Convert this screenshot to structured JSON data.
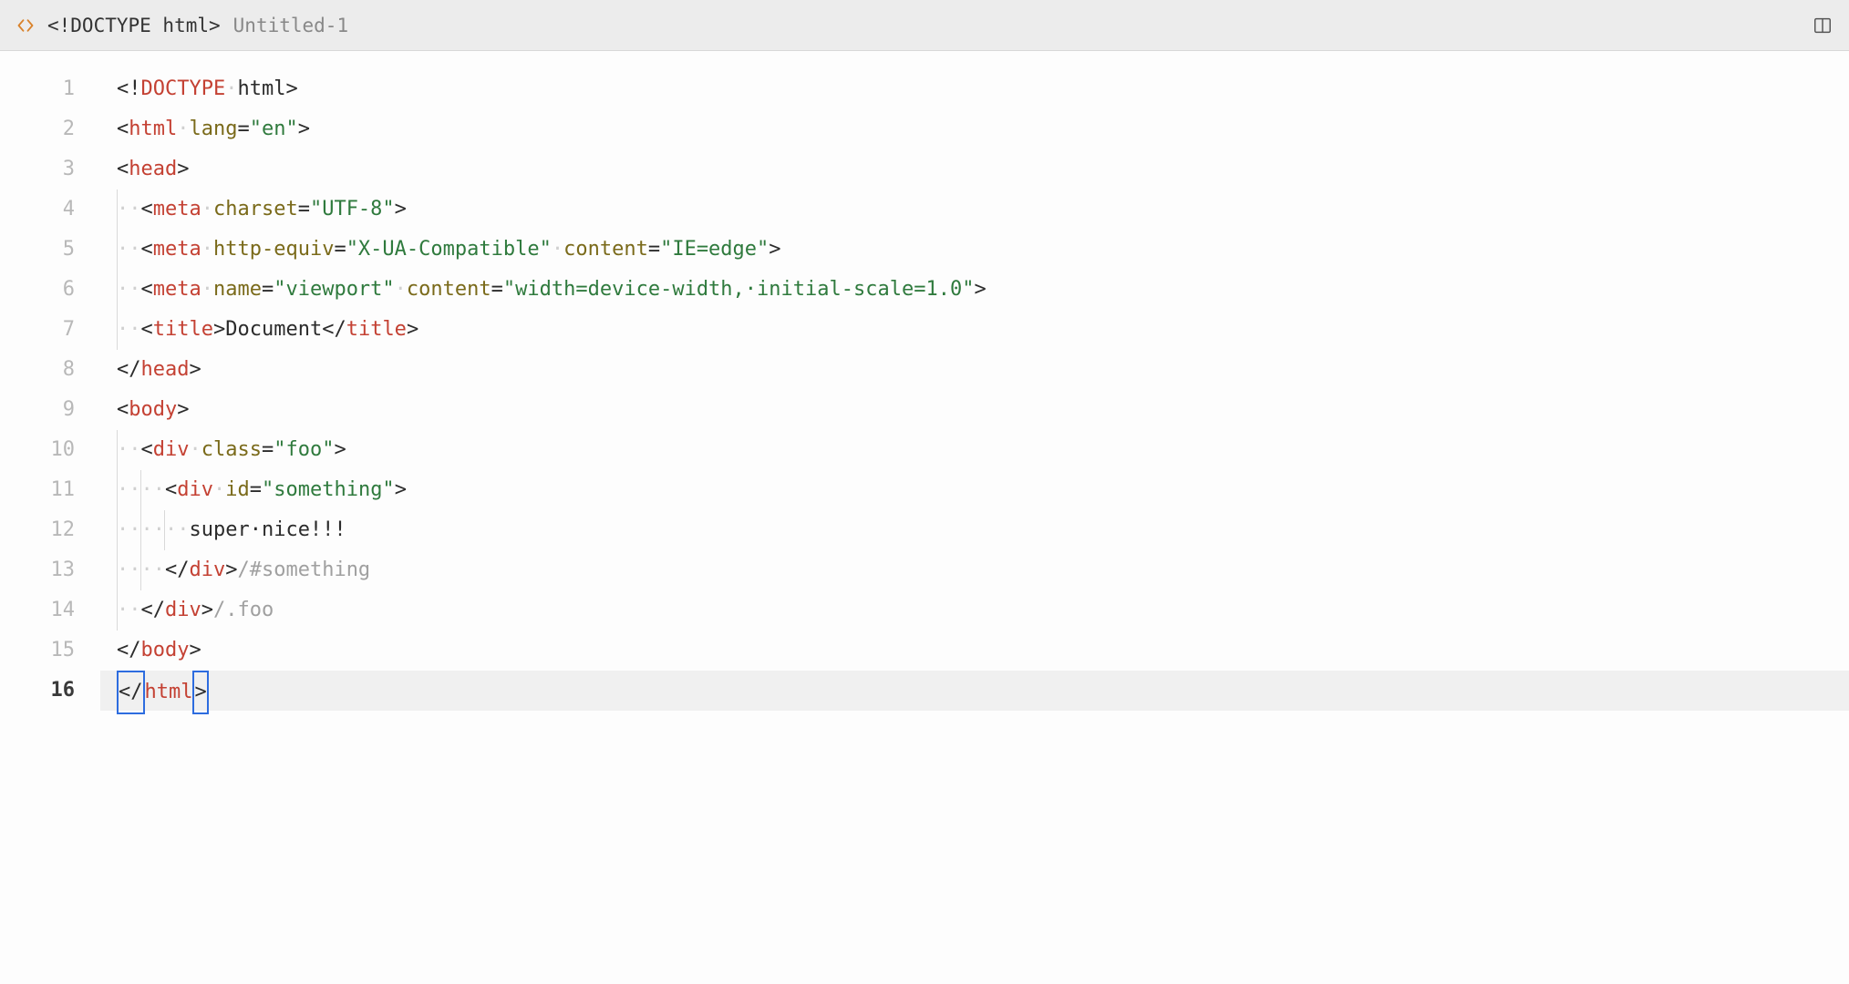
{
  "tab": {
    "doctype_label": "<!DOCTYPE html>",
    "filename": "Untitled-1"
  },
  "gutter": {
    "lines": [
      "1",
      "2",
      "3",
      "4",
      "5",
      "6",
      "7",
      "8",
      "9",
      "10",
      "11",
      "12",
      "13",
      "14",
      "15",
      "16"
    ],
    "current_line": 16
  },
  "code": {
    "line1": {
      "lt": "<",
      "bang": "!",
      "doctype": "DOCTYPE",
      "sp": "·",
      "html": "html",
      "gt": ">"
    },
    "line2": {
      "lt": "<",
      "tag": "html",
      "sp": "·",
      "attr": "lang",
      "eq": "=",
      "val": "\"en\"",
      "gt": ">"
    },
    "line3": {
      "lt": "<",
      "tag": "head",
      "gt": ">"
    },
    "line4": {
      "ws": "··",
      "lt": "<",
      "tag": "meta",
      "sp": "·",
      "attr": "charset",
      "eq": "=",
      "val": "\"UTF-8\"",
      "gt": ">"
    },
    "line5": {
      "ws": "··",
      "lt": "<",
      "tag": "meta",
      "sp": "·",
      "attr1": "http-equiv",
      "eq1": "=",
      "val1": "\"X-UA-Compatible\"",
      "sp2": "·",
      "attr2": "content",
      "eq2": "=",
      "val2": "\"IE=edge\"",
      "gt": ">"
    },
    "line6": {
      "ws": "··",
      "lt": "<",
      "tag": "meta",
      "sp": "·",
      "attr1": "name",
      "eq1": "=",
      "val1": "\"viewport\"",
      "sp2": "·",
      "attr2": "content",
      "eq2": "=",
      "val2": "\"width=device-width,·initial-scale=1.0\"",
      "gt": ">"
    },
    "line7": {
      "ws": "··",
      "lt": "<",
      "tag": "title",
      "gt": ">",
      "text": "Document",
      "lt2": "</",
      "tag2": "title",
      "gt2": ">"
    },
    "line8": {
      "lt": "</",
      "tag": "head",
      "gt": ">"
    },
    "line9": {
      "lt": "<",
      "tag": "body",
      "gt": ">"
    },
    "line10": {
      "ws": "··",
      "lt": "<",
      "tag": "div",
      "sp": "·",
      "attr": "class",
      "eq": "=",
      "val": "\"foo\"",
      "gt": ">"
    },
    "line11": {
      "ws": "····",
      "lt": "<",
      "tag": "div",
      "sp": "·",
      "attr": "id",
      "eq": "=",
      "val": "\"something\"",
      "gt": ">"
    },
    "line12": {
      "ws": "······",
      "text": "super·nice!!!"
    },
    "line13": {
      "ws": "····",
      "lt": "</",
      "tag": "div",
      "gt": ">",
      "comment": "/#something"
    },
    "line14": {
      "ws": "··",
      "lt": "</",
      "tag": "div",
      "gt": ">",
      "comment": "/.foo"
    },
    "line15": {
      "lt": "</",
      "tag": "body",
      "gt": ">"
    },
    "line16": {
      "lt": "</",
      "tag": "html",
      "gt": ">"
    }
  }
}
